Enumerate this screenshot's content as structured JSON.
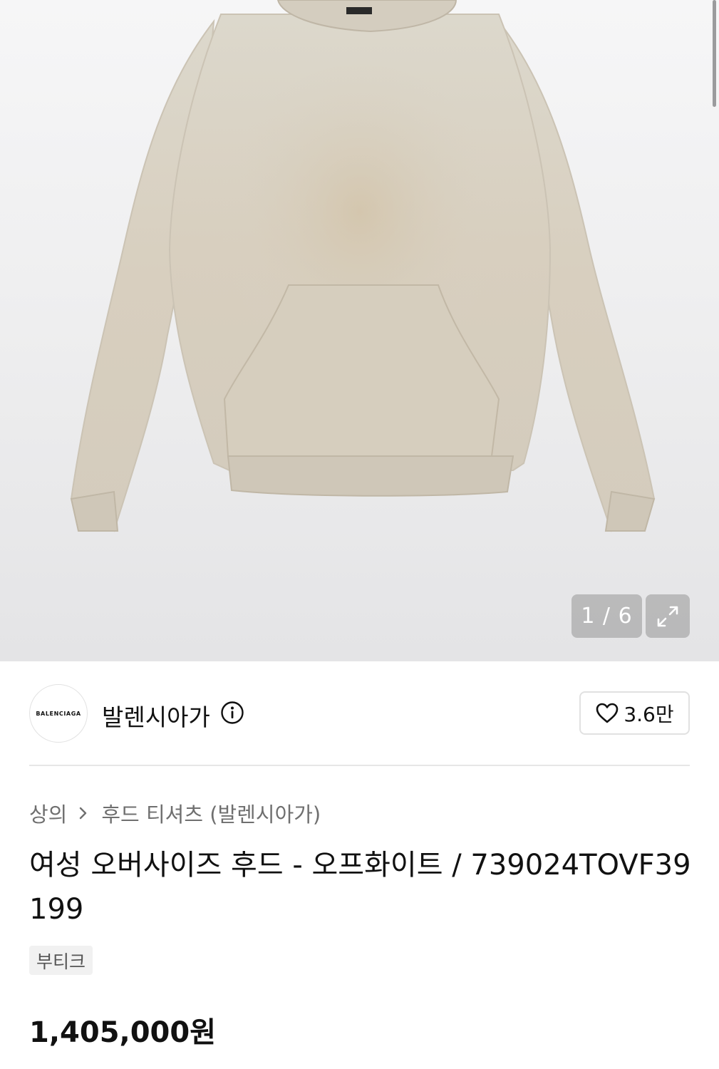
{
  "gallery": {
    "image_alt": "hoodie",
    "counter": "1 / 6",
    "expand_icon": "expand-icon"
  },
  "brand": {
    "logo_text": "BALENCIAGA",
    "name": "발렌시아가",
    "info_icon": "info-icon",
    "like_icon": "heart-icon",
    "like_count": "3.6만"
  },
  "breadcrumb": {
    "category": "상의",
    "separator_icon": "chevron-right-icon",
    "subcategory": "후드 티셔츠 (발렌시아가)"
  },
  "product": {
    "title": "여성 오버사이즈 후드 - 오프화이트 / 739024TOVF39199",
    "tag": "부티크",
    "price": "1,405,000원"
  },
  "colors": {
    "hoodie": "#d9d3c6",
    "background": "#ededee",
    "text": "#111111",
    "muted": "#6f6f6f"
  }
}
